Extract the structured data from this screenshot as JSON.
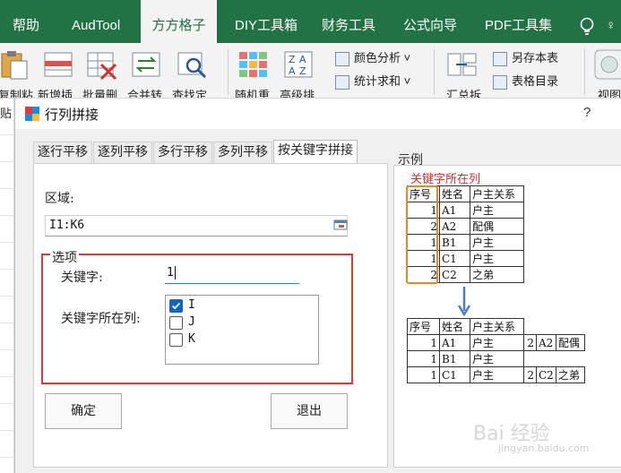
{
  "ribbon_tabs": [
    {
      "label": "帮助",
      "active": false
    },
    {
      "label": "AudTool",
      "active": false
    },
    {
      "label": "方方格子",
      "active": true
    },
    {
      "label": "DIY工具箱",
      "active": false
    },
    {
      "label": "财务工具",
      "active": false
    },
    {
      "label": "公式向导",
      "active": false
    },
    {
      "label": "PDF工具集",
      "active": false
    }
  ],
  "ribbon_tab_extra": "♀",
  "ribbon_tools": {
    "large": [
      {
        "label": "复制粘",
        "icon": "paste-icon"
      },
      {
        "label": "新增插",
        "icon": "insert-row-icon"
      },
      {
        "label": "批量删",
        "icon": "batch-delete-icon"
      },
      {
        "label": "合并转",
        "icon": "merge-convert-icon"
      },
      {
        "label": "查找定",
        "icon": "find-locate-icon"
      },
      {
        "label": "随机重",
        "icon": "random-icon"
      },
      {
        "label": "高级排",
        "icon": "advanced-sort-icon"
      },
      {
        "label": "汇总拆",
        "icon": "summary-split-icon"
      },
      {
        "label": "视图",
        "icon": "view-icon"
      }
    ],
    "small": [
      {
        "label": "颜色分析",
        "icon": "color-analysis-icon",
        "dropdown": "˅"
      },
      {
        "label": "统计求和",
        "icon": "stat-sum-icon",
        "dropdown": "˅"
      },
      {
        "label": "另存本表",
        "icon": "save-sheet-icon"
      },
      {
        "label": "表格目录",
        "icon": "table-toc-icon"
      }
    ]
  },
  "sheet": {
    "paste_label": "贴"
  },
  "dialog": {
    "title": "行列拼接",
    "help": "?",
    "tabs": [
      {
        "label": "逐行平移",
        "active": false
      },
      {
        "label": "逐列平移",
        "active": false
      },
      {
        "label": "多行平移",
        "active": false
      },
      {
        "label": "多列平移",
        "active": false
      },
      {
        "label": "按关键字拼接",
        "active": true
      }
    ],
    "range_label": "区域:",
    "range_value": "I1:K6",
    "options_label": "选项",
    "keyword_label": "关键字:",
    "keyword_value": "1",
    "column_label": "关键字所在列:",
    "columns": [
      {
        "label": "I",
        "checked": true
      },
      {
        "label": "J",
        "checked": false
      },
      {
        "label": "K",
        "checked": false
      }
    ],
    "ok_label": "确定",
    "exit_label": "退出"
  },
  "example": {
    "title": "示例",
    "caption": "关键字所在列",
    "source_table": {
      "headers": [
        "序号",
        "姓名",
        "户主关系"
      ],
      "rows": [
        [
          "1",
          "A1",
          "户主"
        ],
        [
          "2",
          "A2",
          "配偶"
        ],
        [
          "1",
          "B1",
          "户主"
        ],
        [
          "1",
          "C1",
          "户主"
        ],
        [
          "2",
          "C2",
          "之弟"
        ]
      ]
    },
    "result_table": {
      "headers": [
        "序号",
        "姓名",
        "户主关系"
      ],
      "rows": [
        [
          "1",
          "A1",
          "户主",
          "2",
          "A2",
          "配偶"
        ],
        [
          "1",
          "B1",
          "户主",
          "",
          "",
          ""
        ],
        [
          "1",
          "C1",
          "户主",
          "2",
          "C2",
          "之弟"
        ]
      ]
    }
  },
  "watermark": {
    "text": "Bai 经验",
    "sub": "jingyan.baidu.com"
  },
  "colors": {
    "ribbon_green": "#217346",
    "highlight_red": "#e0383b",
    "highlight_orange": "#e08a2a",
    "checkbox_blue": "#1565c0"
  }
}
